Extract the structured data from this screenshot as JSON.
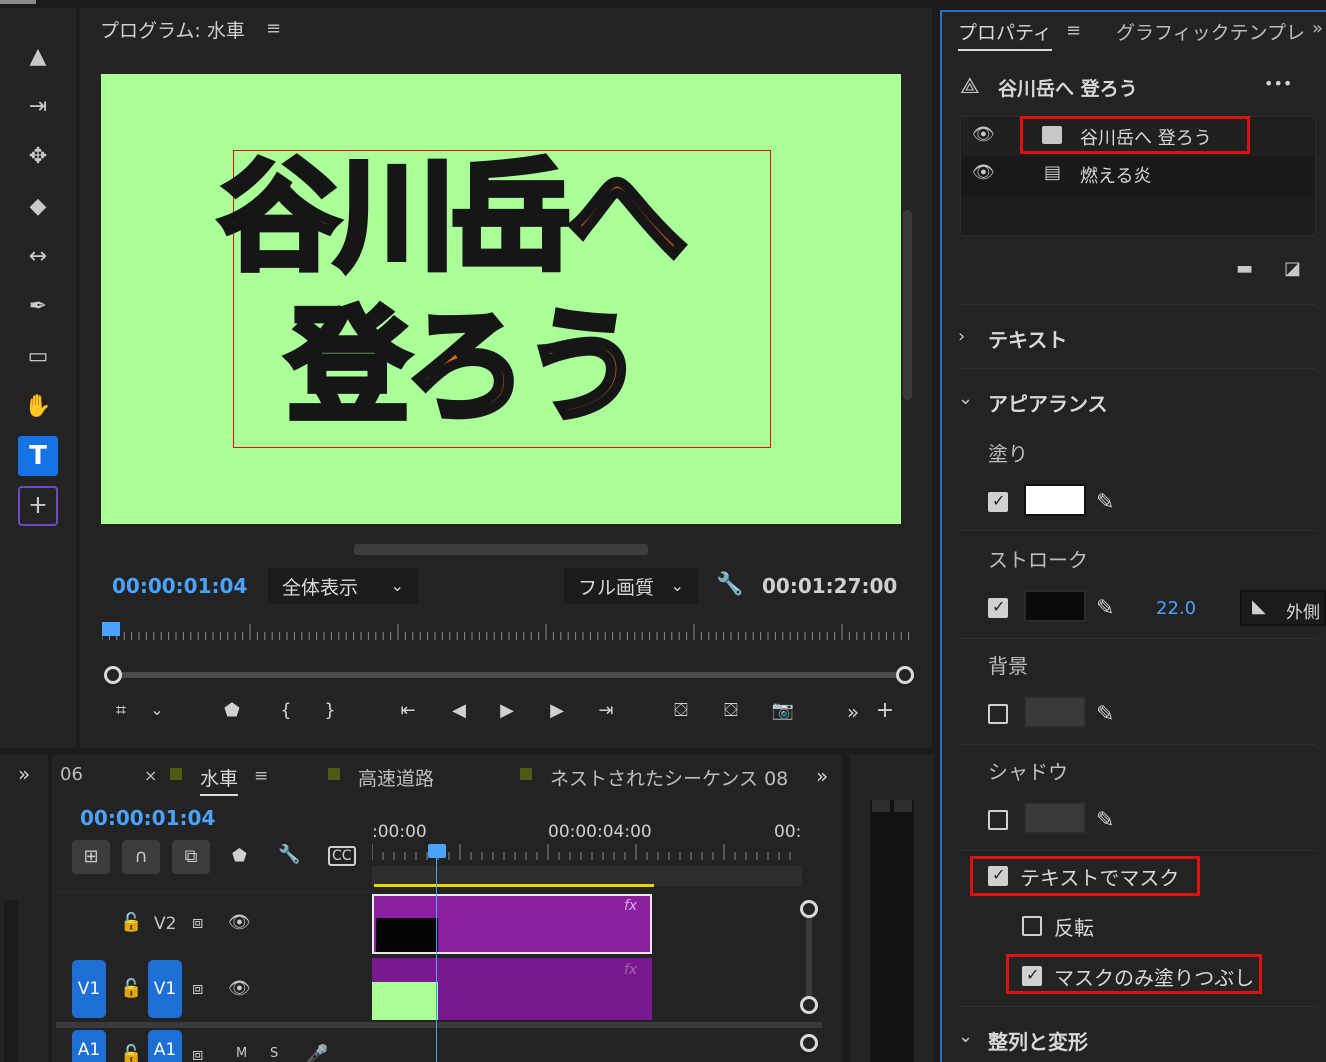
{
  "program_monitor": {
    "title": "プログラム: 水車",
    "menu_glyph": "≡",
    "title_text_line1": "谷川岳へ",
    "title_text_line2": "登ろう",
    "playhead_time": "00:00:01:04",
    "zoom_dropdown": "全体表示",
    "quality_dropdown": "フル画質",
    "duration": "00:01:27:00",
    "overflow_glyph": "»",
    "add_glyph": "+"
  },
  "tools": [
    {
      "name": "selection-tool",
      "glyph": "▲"
    },
    {
      "name": "track-select-tool",
      "glyph": "⇥"
    },
    {
      "name": "ripple-edit-tool",
      "glyph": "✥"
    },
    {
      "name": "razor-tool",
      "glyph": "◆"
    },
    {
      "name": "slip-tool",
      "glyph": "↔"
    },
    {
      "name": "pen-tool",
      "glyph": "✒"
    },
    {
      "name": "rectangle-tool",
      "glyph": "▭"
    },
    {
      "name": "hand-tool",
      "glyph": "✋"
    },
    {
      "name": "type-tool",
      "glyph": "T"
    },
    {
      "name": "vertical-type-tool",
      "glyph": "ⵜ"
    }
  ],
  "properties_panel": {
    "tab_active": "プロパティ",
    "tab_menu": "≡",
    "tab_other": "グラフィックテンプレ",
    "overflow": "»",
    "clip_title": "谷川岳へ 登ろう",
    "more": "•••",
    "layers": [
      {
        "label": "谷川岳へ 登ろう",
        "selected": true
      },
      {
        "label": "燃える炎",
        "selected": false
      }
    ],
    "sections": {
      "text": "テキスト",
      "appearance": "アピアランス",
      "align": "整列と変形"
    },
    "fill_label": "塗り",
    "fill_color": "#ffffff",
    "fill_checked": true,
    "stroke_label": "ストローク",
    "stroke_color": "#0a0a0a",
    "stroke_checked": true,
    "stroke_width": "22.0",
    "stroke_type": "外側",
    "background_label": "背景",
    "background_checked": false,
    "shadow_label": "シャドウ",
    "shadow_checked": false,
    "mask_with_text": "テキストでマスク",
    "mask_with_text_checked": true,
    "invert": "反転",
    "invert_checked": false,
    "mask_fill_only": "マスクのみ塗りつぶし",
    "mask_fill_only_checked": true
  },
  "timeline": {
    "left_overflow": "»",
    "panel_number": "06",
    "tab_close": "×",
    "tab_active": "水車",
    "tab_menu": "≡",
    "tab_2": "高速道路",
    "tab_3": "ネストされたシーケンス 08",
    "right_overflow": "»",
    "timecode": "00:00:01:04",
    "ruler_labels": [
      ":00:00",
      "00:00:04:00",
      "00:"
    ],
    "tracks": [
      {
        "name": "V2",
        "source": ""
      },
      {
        "name": "V1",
        "source": "V1"
      },
      {
        "name": "A1",
        "source": "A1"
      }
    ],
    "fx_label": "fx"
  },
  "colors": {
    "accent_blue": "#1473e6",
    "timecode_blue": "#4aa3ff",
    "clip_purple": "#8a1fa0",
    "canvas_green": "#aaff99",
    "highlight_red": "#e01010"
  }
}
